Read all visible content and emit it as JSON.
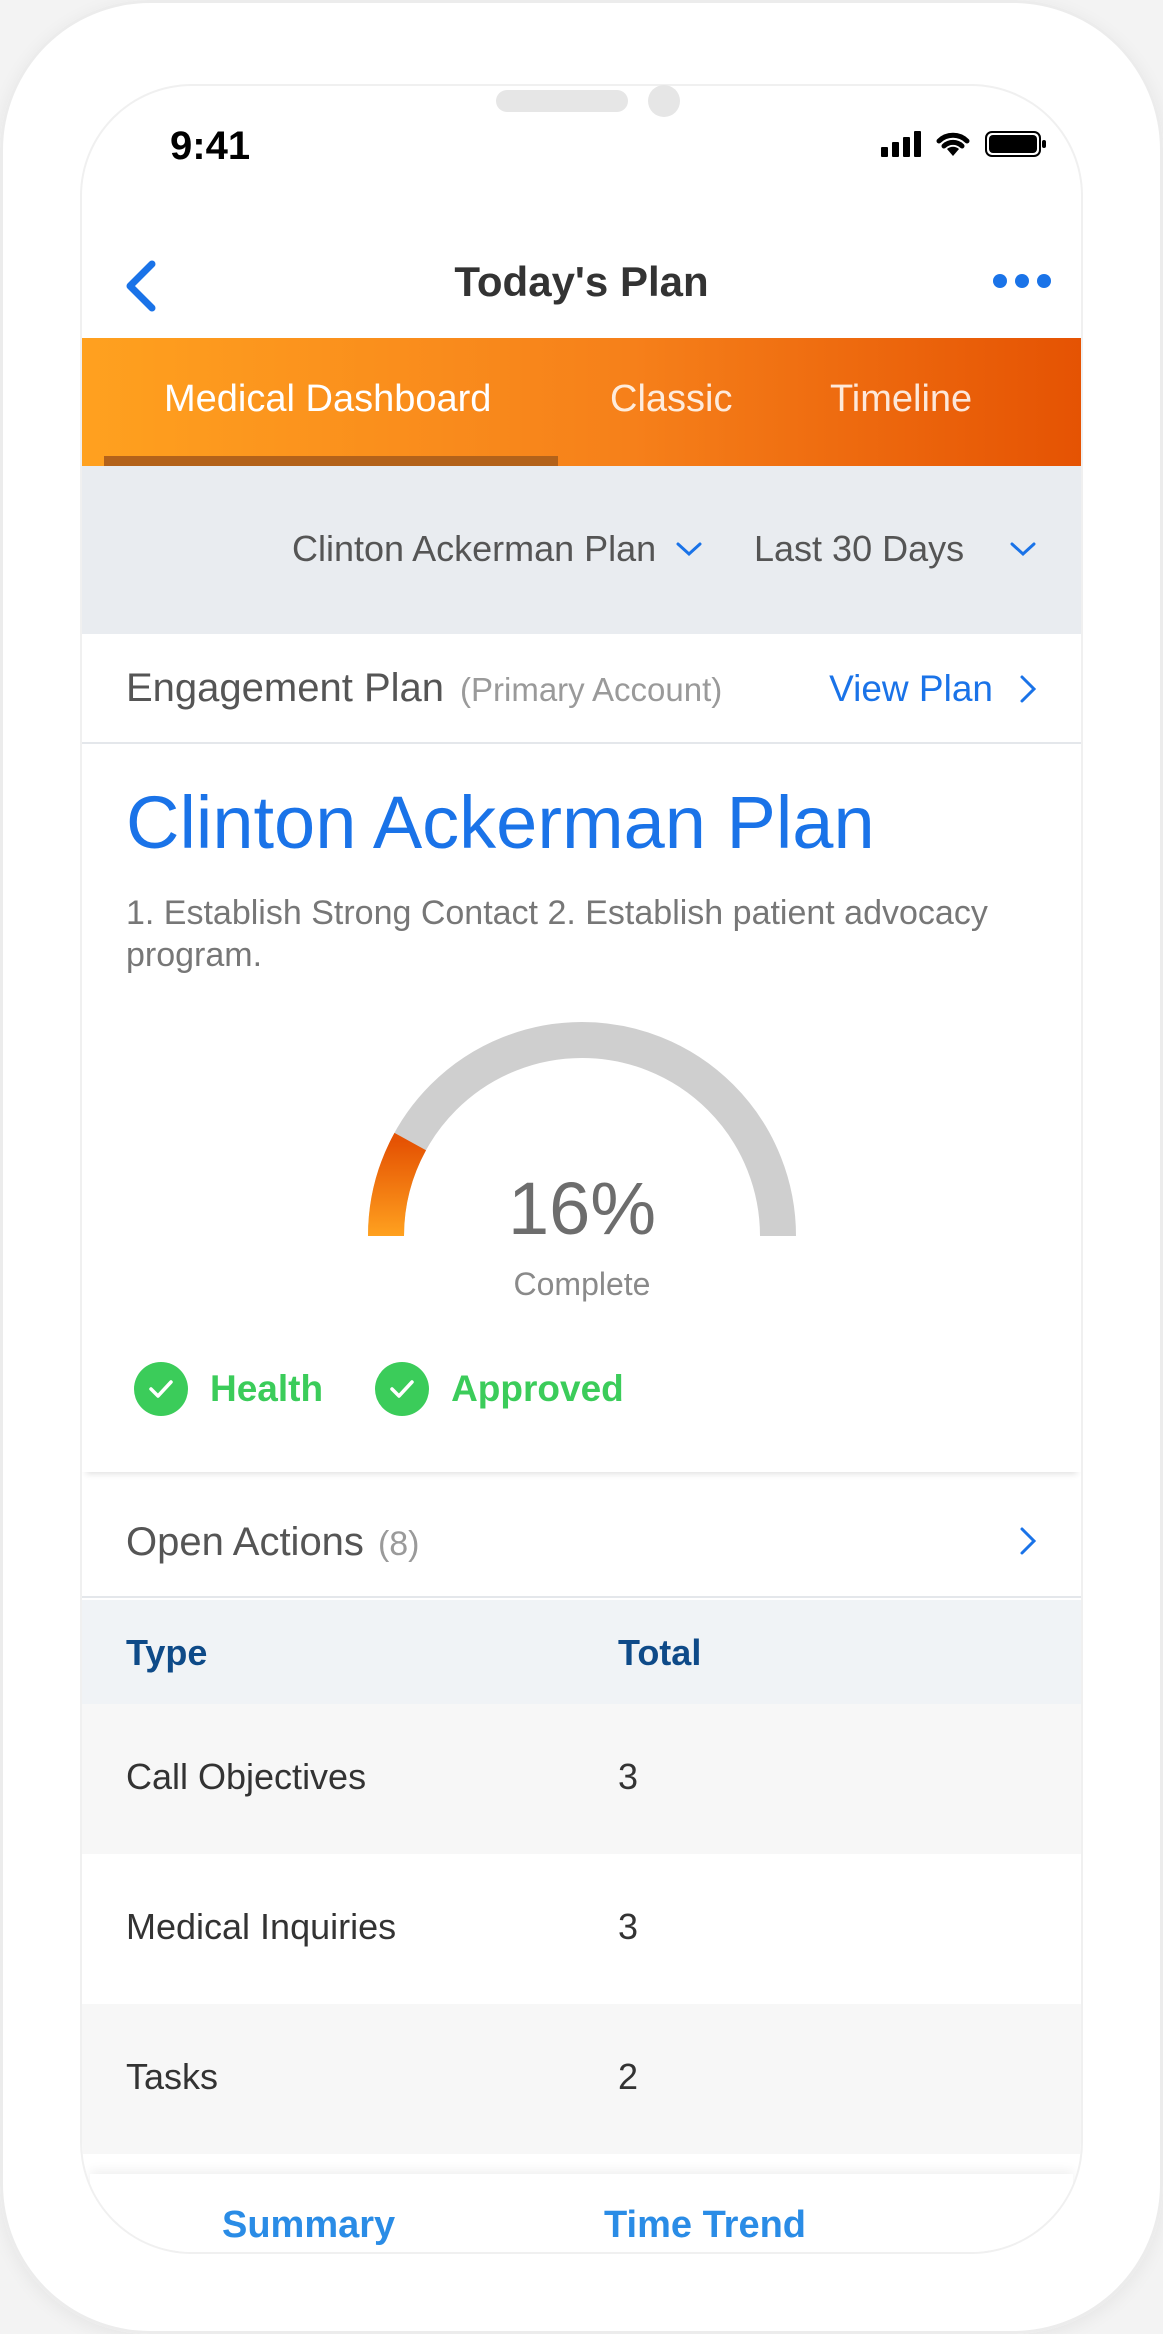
{
  "status_bar": {
    "time": "9:41"
  },
  "nav": {
    "title": "Today's Plan"
  },
  "tabs": [
    {
      "label": "Medical Dashboard"
    },
    {
      "label": "Classic"
    },
    {
      "label": "Timeline"
    }
  ],
  "filters": {
    "plan_select": "Clinton Ackerman Plan",
    "range_select": "Last 30 Days"
  },
  "engagement": {
    "title": "Engagement Plan",
    "subtitle": "(Primary Account)",
    "view_link": "View Plan"
  },
  "plan": {
    "name": "Clinton Ackerman Plan",
    "description": "1. Establish Strong Contact 2. Establish patient advocacy program.",
    "progress_percent_label": "16%",
    "progress_fraction": 0.16,
    "progress_caption": "Complete",
    "badges": [
      {
        "label": "Health"
      },
      {
        "label": "Approved"
      }
    ]
  },
  "open_actions": {
    "title": "Open Actions",
    "count": "(8)",
    "columns": [
      "Type",
      "Total"
    ],
    "rows": [
      {
        "type": "Call Objectives",
        "total": "3"
      },
      {
        "type": "Medical Inquiries",
        "total": "3"
      },
      {
        "type": "Tasks",
        "total": "2"
      }
    ]
  },
  "bottom_tabs": [
    {
      "label": "Summary"
    },
    {
      "label": "Time Trend"
    }
  ],
  "colors": {
    "accent_blue": "#1a73e8",
    "tab_gradient_start": "#ffa11f",
    "tab_gradient_end": "#e55303",
    "success_green": "#3bcc5a",
    "table_header_text": "#0e4a88"
  }
}
